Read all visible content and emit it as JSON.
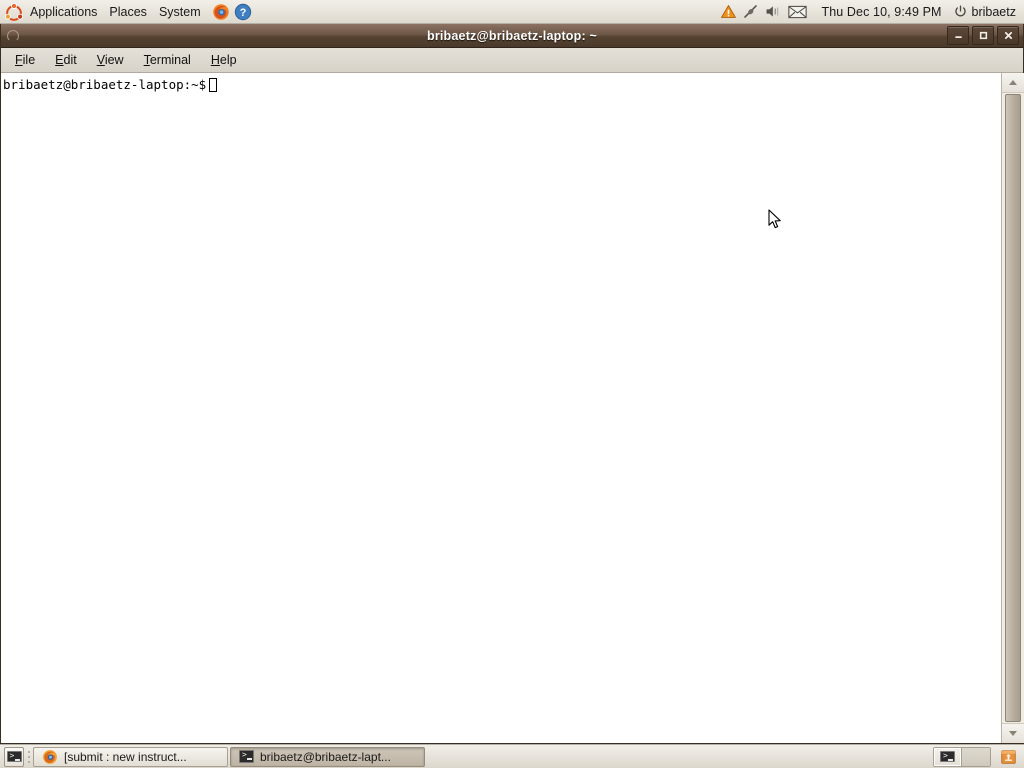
{
  "top_panel": {
    "logo": "ubuntu-logo",
    "menus": [
      {
        "label": "Applications",
        "name": "applications-menu"
      },
      {
        "label": "Places",
        "name": "places-menu"
      },
      {
        "label": "System",
        "name": "system-menu"
      }
    ],
    "launchers": [
      {
        "name": "firefox-launcher-icon",
        "title": "Firefox Web Browser"
      },
      {
        "name": "help-launcher-icon",
        "title": "Help"
      }
    ],
    "tray": [
      {
        "name": "update-warning-icon"
      },
      {
        "name": "network-plug-icon"
      },
      {
        "name": "volume-icon"
      },
      {
        "name": "mail-envelope-icon"
      }
    ],
    "clock": "Thu Dec 10,  9:49 PM",
    "user": "bribaetz",
    "power_icon": "power-icon"
  },
  "window": {
    "title": "bribaetz@bribaetz-laptop: ~",
    "buttons": {
      "minimize": "–",
      "maximize": "□",
      "close": "✕"
    },
    "menubar": [
      {
        "label": "File",
        "mnemonic": "F",
        "rest": "ile",
        "name": "menu-file"
      },
      {
        "label": "Edit",
        "mnemonic": "E",
        "rest": "dit",
        "name": "menu-edit"
      },
      {
        "label": "View",
        "mnemonic": "V",
        "rest": "iew",
        "name": "menu-view"
      },
      {
        "label": "Terminal",
        "mnemonic": "T",
        "rest": "erminal",
        "name": "menu-terminal"
      },
      {
        "label": "Help",
        "mnemonic": "H",
        "rest": "elp",
        "name": "menu-help"
      }
    ],
    "terminal": {
      "prompt": "bribaetz@bribaetz-laptop:~$",
      "output": "",
      "background_color": "#ffffff",
      "text_color": "#000000"
    }
  },
  "bottom_panel": {
    "show_desktop": "show-desktop-button",
    "tasks": [
      {
        "label": "[submit : new instruct...",
        "icon": "firefox-icon",
        "active": false,
        "name": "taskbar-button-firefox"
      },
      {
        "label": "bribaetz@bribaetz-lapt...",
        "icon": "terminal-icon",
        "active": true,
        "name": "taskbar-button-terminal"
      }
    ],
    "workspaces": [
      {
        "name": "workspace-1",
        "active": true
      },
      {
        "name": "workspace-2",
        "active": false
      }
    ],
    "trash": "trash-icon"
  },
  "colors": {
    "panel_bg": "#e8e4dc",
    "titlebar_top": "#8b7263",
    "titlebar_bottom": "#4b3a2c",
    "desktop_accent": "#dd4814",
    "terminal_bg": "#ffffff"
  }
}
